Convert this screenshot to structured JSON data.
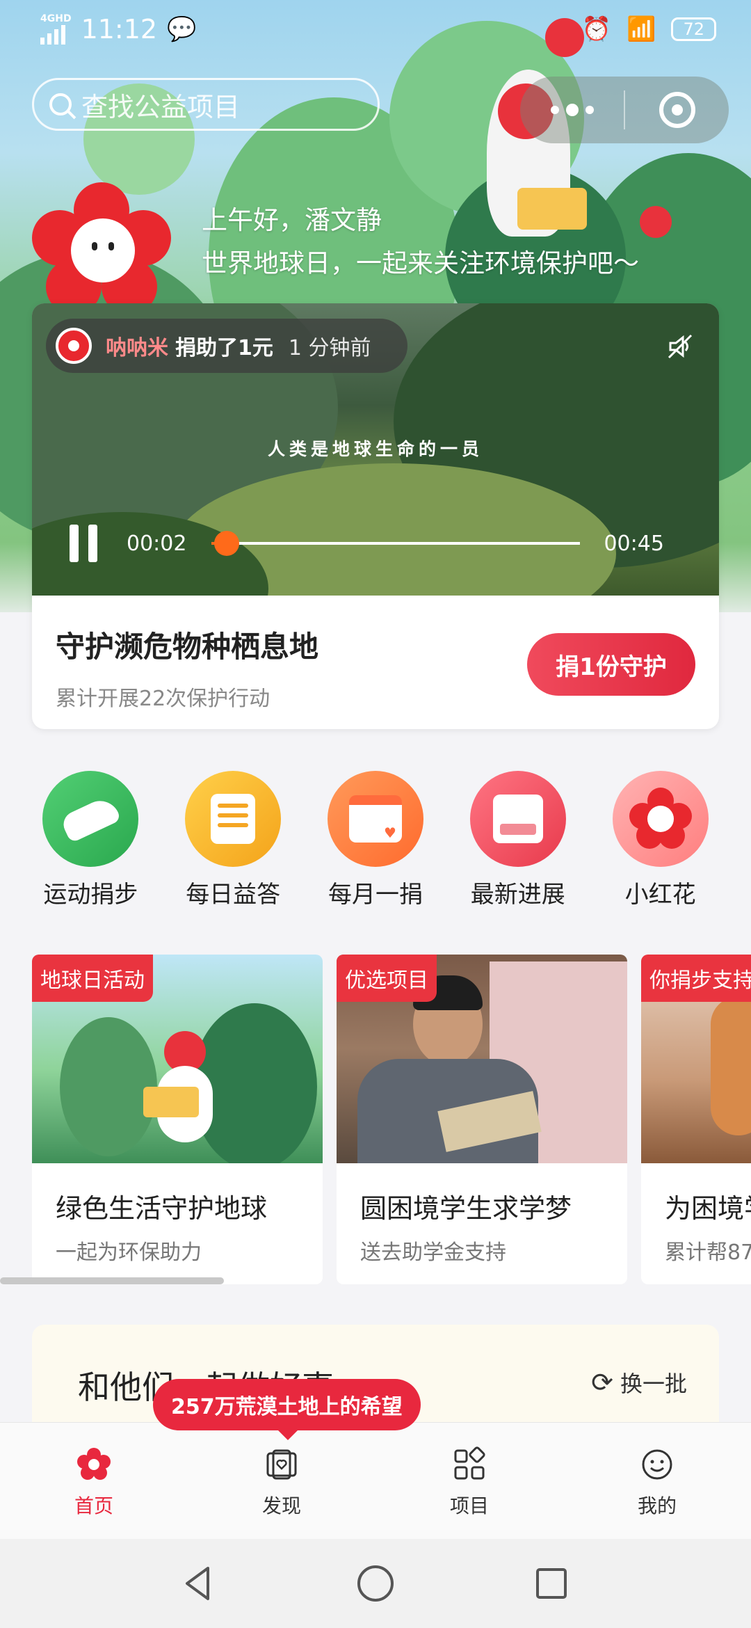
{
  "status_bar": {
    "network": "4GHD",
    "time": "11:12",
    "battery": "72"
  },
  "search": {
    "placeholder": "查找公益项目"
  },
  "greeting": {
    "line1": "上午好，潘文静",
    "line2": "世界地球日，一起来关注环境保护吧～"
  },
  "video": {
    "donor_name": "呐呐米",
    "donor_action": "捐助了1元",
    "donor_time": "1 分钟前",
    "caption": "人类是地球生命的一员",
    "current_time": "00:02",
    "total_time": "00:45",
    "progress": 0.04,
    "title": "守护濒危物种栖息地",
    "subtitle": "累计开展22次保护行动",
    "donate_label": "捐1份守护"
  },
  "shortcuts": [
    {
      "label": "运动捐步",
      "icon": "shoe-icon",
      "color": "#3cb95a"
    },
    {
      "label": "每日益答",
      "icon": "document-icon",
      "color": "#f9b71e"
    },
    {
      "label": "每月一捐",
      "icon": "calendar-icon",
      "color": "#ff7a3c"
    },
    {
      "label": "最新进展",
      "icon": "inbox-icon",
      "color": "#ef4f5e"
    },
    {
      "label": "小红花",
      "icon": "flower-icon",
      "color": "#ff8b8b"
    }
  ],
  "projects": [
    {
      "tag": "地球日活动",
      "title": "绿色生活守护地球",
      "subtitle": "一起为环保助力"
    },
    {
      "tag": "优选项目",
      "title": "圆困境学生求学梦",
      "subtitle": "送去助学金支持"
    },
    {
      "tag": "你捐步支持",
      "title": "为困境学",
      "subtitle": "累计帮87"
    }
  ],
  "together": {
    "title": "和他们一起做好事",
    "refresh_label": "换一批"
  },
  "promo": {
    "text": "257万荒漠土地上的希望"
  },
  "tabs": [
    {
      "label": "首页",
      "icon": "flower-icon",
      "active": true
    },
    {
      "label": "发现",
      "icon": "discover-icon",
      "active": false
    },
    {
      "label": "项目",
      "icon": "grid-icon",
      "active": false
    },
    {
      "label": "我的",
      "icon": "smile-icon",
      "active": false
    }
  ],
  "colors": {
    "accent": "#e8283e",
    "progress": "#ff6a1a"
  }
}
